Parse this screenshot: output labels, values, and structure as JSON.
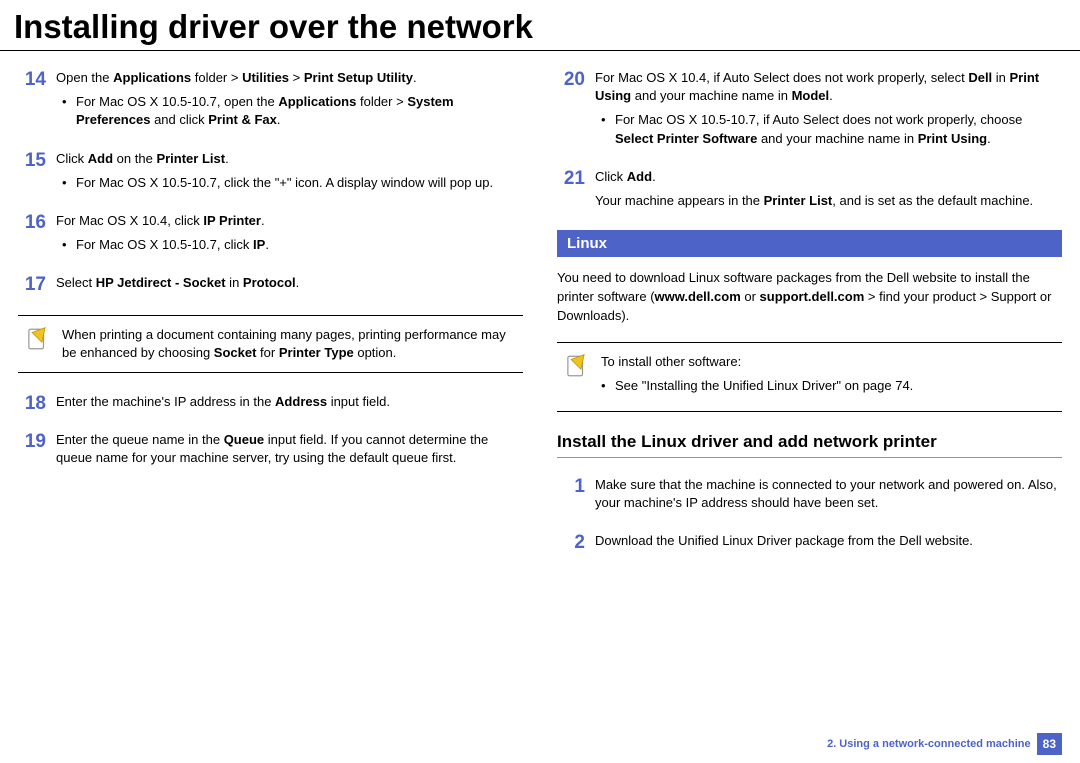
{
  "title": "Installing driver over the network",
  "left": {
    "s14": {
      "num": "14",
      "main_a": "Open the ",
      "main_b": "Applications",
      "main_c": " folder > ",
      "main_d": "Utilities",
      "main_e": " > ",
      "main_f": "Print Setup Utility",
      "main_g": ".",
      "bul_a": "For Mac OS X 10.5-10.7, open the ",
      "bul_b": "Applications",
      "bul_c": " folder > ",
      "bul_d": "System Preferences",
      "bul_e": " and click ",
      "bul_f": "Print & Fax",
      "bul_g": "."
    },
    "s15": {
      "num": "15",
      "main_a": "Click ",
      "main_b": "Add",
      "main_c": " on the ",
      "main_d": "Printer List",
      "main_e": ".",
      "bul": "For Mac OS X 10.5-10.7, click the \"+\" icon. A display window will pop up."
    },
    "s16": {
      "num": "16",
      "main_a": "For Mac OS X 10.4, click ",
      "main_b": "IP Printer",
      "main_c": ".",
      "bul_a": "For Mac OS X 10.5-10.7, click ",
      "bul_b": "IP",
      "bul_c": "."
    },
    "s17": {
      "num": "17",
      "main_a": "Select ",
      "main_b": "HP Jetdirect - Socket",
      "main_c": " in ",
      "main_d": "Protocol",
      "main_e": "."
    },
    "note": {
      "a": "When printing a document containing many pages, printing performance may be enhanced by choosing ",
      "b": "Socket",
      "c": " for ",
      "d": "Printer Type",
      "e": " option."
    },
    "s18": {
      "num": "18",
      "main_a": "Enter the machine's IP address in the ",
      "main_b": "Address",
      "main_c": " input field."
    },
    "s19": {
      "num": "19",
      "main_a": "Enter the queue name in the ",
      "main_b": "Queue",
      "main_c": " input field. If you cannot determine the queue name for your machine server, try using the default queue first."
    }
  },
  "right": {
    "s20": {
      "num": "20",
      "main_a": "For Mac OS X 10.4, if Auto Select does not work properly, select ",
      "main_b": "Dell",
      "main_c": " in ",
      "main_d": "Print Using",
      "main_e": " and your machine name in ",
      "main_f": "Model",
      "main_g": ".",
      "bul_a": "For Mac OS X 10.5-10.7, if Auto Select does not work properly, choose ",
      "bul_b": "Select Printer Software",
      "bul_c": " and your machine name in ",
      "bul_d": "Print Using",
      "bul_e": "."
    },
    "s21": {
      "num": "21",
      "main_a": "Click ",
      "main_b": "Add",
      "main_c": ".",
      "p2_a": "Your machine appears in the ",
      "p2_b": "Printer List",
      "p2_c": ", and is set as the default machine."
    },
    "section": "Linux",
    "intro_a": "You need to download Linux software packages from the Dell website to install the printer software (",
    "intro_b": "www.dell.com",
    "intro_c": " or ",
    "intro_d": "support.dell.com",
    "intro_e": " > find your product > Support or Downloads).",
    "note2": {
      "a": "To install other software:",
      "b": "See \"Installing the Unified Linux Driver\" on page 74."
    },
    "subhead": "Install the Linux driver and add network printer",
    "l1": {
      "num": "1",
      "text": "Make sure that the machine is connected to your network and powered on. Also, your machine's IP address should have been set."
    },
    "l2": {
      "num": "2",
      "text": "Download the Unified Linux Driver package from the Dell website."
    }
  },
  "footer": {
    "chapter": "2.  Using a network-connected machine",
    "page": "83"
  }
}
